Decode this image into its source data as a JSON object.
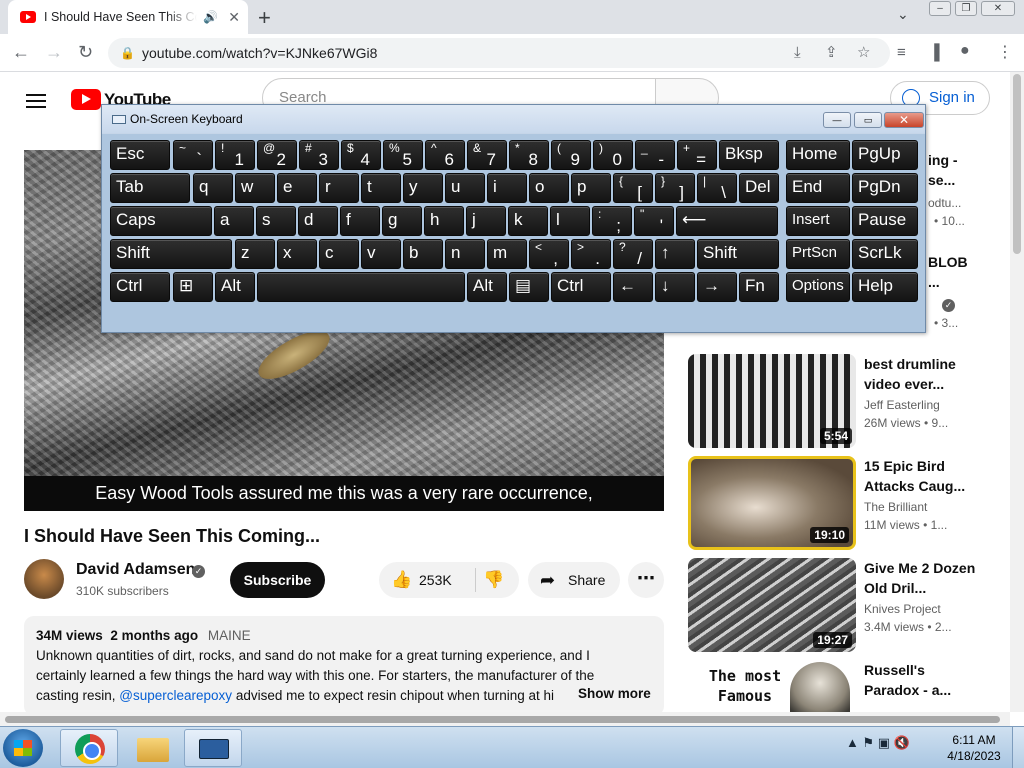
{
  "browser": {
    "tab_title": "I Should Have Seen This Coming...",
    "tab_audio_icon": "speaker-icon",
    "tab_close": "✕",
    "new_tab": "+",
    "url": "youtube.com/watch?v=KJNke67WGi8"
  },
  "youtube": {
    "logo_text": "YouTube",
    "search_placeholder": "Search",
    "sign_in": "Sign in",
    "caption": "Easy Wood Tools assured me this was a very rare occurrence,",
    "video_title": "I Should Have Seen This Coming...",
    "channel_name": "David Adamsen",
    "verified": "✓",
    "subscribers": "310K subscribers",
    "subscribe": "Subscribe",
    "likes": "253K",
    "share": "Share",
    "more": "⋯",
    "description": {
      "views": "34M views",
      "date": "2 months ago",
      "tag": "MAINE",
      "line1": "Unknown quantities of dirt, rocks, and sand do not make for a great turning experience, and I",
      "line2": "certainly learned a few things the hard way with this one.  For starters, the manufacturer of the",
      "line3_pre": "casting resin, ",
      "line3_link": "@superclearepoxy",
      "line3_post": "  advised me to expect resin chipout when turning at hi",
      "show_more": "Show more"
    },
    "partial_recs": [
      {
        "title1": "ing -",
        "title2": "se...",
        "chan": "odtu...",
        "meta": "• 10..."
      },
      {
        "title1": "BLOB",
        "title2": "...",
        "meta": "• 3..."
      }
    ],
    "recommendations": [
      {
        "title": "best drumline video ever...",
        "channel": "Jeff Easterling",
        "meta": "26M views  •  9...",
        "duration": "5:54"
      },
      {
        "title": "15 Epic Bird Attacks Caug...",
        "channel": "The Brilliant",
        "meta": "11M views  •  1...",
        "duration": "19:10"
      },
      {
        "title": "Give Me 2 Dozen Old Dril...",
        "channel": "Knives Project",
        "meta": "3.4M views  •  2...",
        "duration": "19:27"
      },
      {
        "title": "Russell's Paradox - a...",
        "thumb_text": "The most Famous",
        "channel": "",
        "meta": ""
      }
    ]
  },
  "osk": {
    "title": "On-Screen Keyboard",
    "rows": [
      [
        {
          "l": "Esc"
        },
        {
          "u": "~",
          "lo": "`"
        },
        {
          "u": "!",
          "lo": "1"
        },
        {
          "u": "@",
          "lo": "2"
        },
        {
          "u": "#",
          "lo": "3"
        },
        {
          "u": "$",
          "lo": "4"
        },
        {
          "u": "%",
          "lo": "5"
        },
        {
          "u": "^",
          "lo": "6"
        },
        {
          "u": "&",
          "lo": "7"
        },
        {
          "u": "*",
          "lo": "8"
        },
        {
          "u": "(",
          "lo": "9"
        },
        {
          "u": ")",
          "lo": "0"
        },
        {
          "u": "_",
          "lo": "-"
        },
        {
          "u": "+",
          "lo": "="
        },
        {
          "l": "Bksp"
        },
        {
          "l": "Home"
        },
        {
          "l": "PgUp"
        }
      ],
      [
        {
          "l": "Tab"
        },
        {
          "l": "q"
        },
        {
          "l": "w"
        },
        {
          "l": "e"
        },
        {
          "l": "r"
        },
        {
          "l": "t"
        },
        {
          "l": "y"
        },
        {
          "l": "u"
        },
        {
          "l": "i"
        },
        {
          "l": "o"
        },
        {
          "l": "p"
        },
        {
          "u": "{",
          "lo": "["
        },
        {
          "u": "}",
          "lo": "]"
        },
        {
          "u": "|",
          "lo": "\\"
        },
        {
          "l": "Del"
        },
        {
          "l": "End"
        },
        {
          "l": "PgDn"
        }
      ],
      [
        {
          "l": "Caps"
        },
        {
          "l": "a"
        },
        {
          "l": "s"
        },
        {
          "l": "d"
        },
        {
          "l": "f"
        },
        {
          "l": "g"
        },
        {
          "l": "h"
        },
        {
          "l": "j"
        },
        {
          "l": "k"
        },
        {
          "l": "l"
        },
        {
          "u": ":",
          "lo": ";"
        },
        {
          "u": "\"",
          "lo": "'"
        },
        {
          "l": "⟵"
        },
        {
          "l": "Insert"
        },
        {
          "l": "Pause"
        }
      ],
      [
        {
          "l": "Shift"
        },
        {
          "l": "z"
        },
        {
          "l": "x"
        },
        {
          "l": "c"
        },
        {
          "l": "v"
        },
        {
          "l": "b"
        },
        {
          "l": "n"
        },
        {
          "l": "m"
        },
        {
          "u": "<",
          "lo": ","
        },
        {
          "u": ">",
          "lo": "."
        },
        {
          "u": "?",
          "lo": "/"
        },
        {
          "l": "↑"
        },
        {
          "l": "Shift"
        },
        {
          "l": "PrtScn"
        },
        {
          "l": "ScrLk"
        }
      ],
      [
        {
          "l": "Ctrl"
        },
        {
          "l": "⊞"
        },
        {
          "l": "Alt"
        },
        {
          "l": ""
        },
        {
          "l": "Alt"
        },
        {
          "l": "▤"
        },
        {
          "l": "Ctrl"
        },
        {
          "l": "←"
        },
        {
          "l": "↓"
        },
        {
          "l": "→"
        },
        {
          "l": "Fn"
        },
        {
          "l": "Options"
        },
        {
          "l": "Help"
        }
      ]
    ]
  },
  "taskbar": {
    "time": "6:11 AM",
    "date": "4/18/2023",
    "tray": "▲  ⚑  ▣  🔇"
  },
  "colors": {
    "youtube_red": "#ff0000",
    "link_blue": "#065fd4",
    "osk_key": "#1e1e1e"
  }
}
